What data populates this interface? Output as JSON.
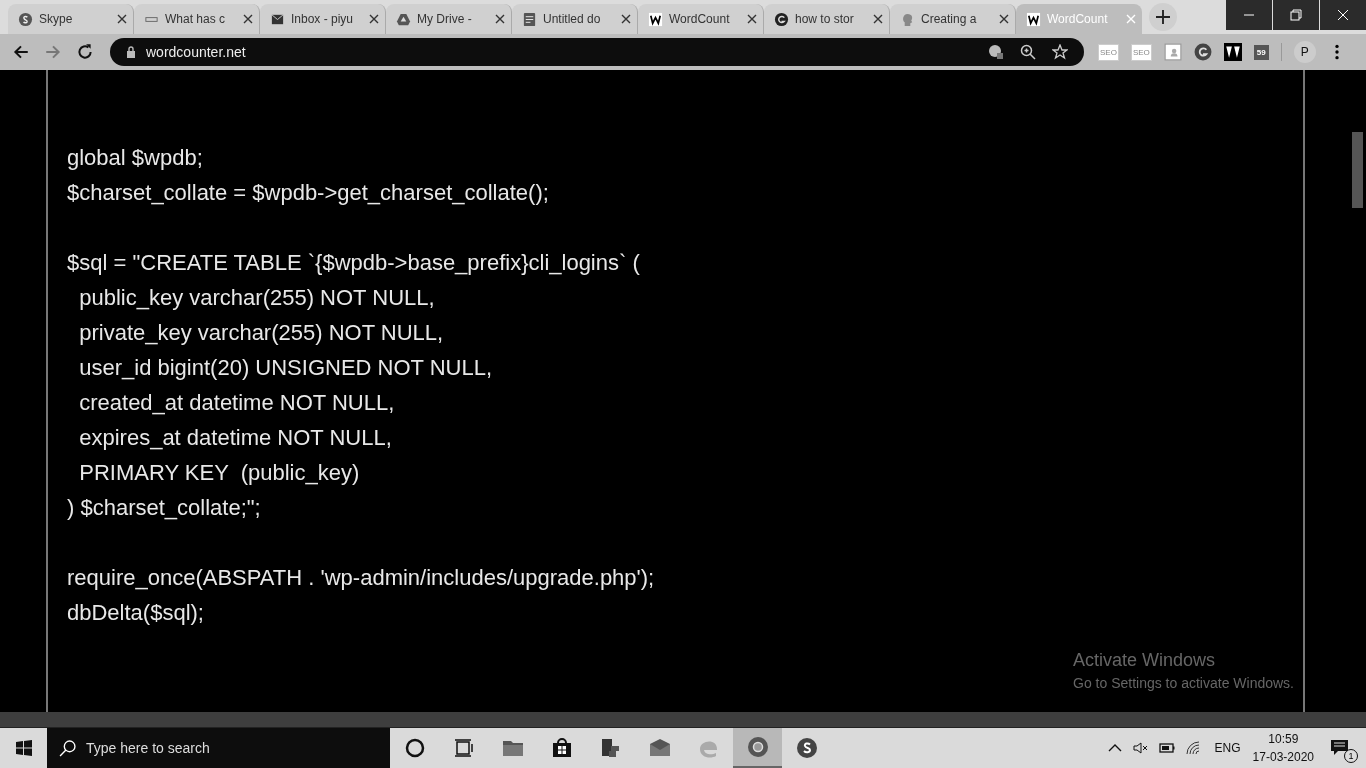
{
  "tabs": [
    {
      "title": "Skype",
      "kind": "skype",
      "selected": false
    },
    {
      "title": "What has c",
      "kind": "dsm",
      "selected": false
    },
    {
      "title": "Inbox - piyu",
      "kind": "mail",
      "selected": false
    },
    {
      "title": "My Drive -",
      "kind": "drive",
      "selected": false
    },
    {
      "title": "Untitled do",
      "kind": "doc",
      "selected": false
    },
    {
      "title": "WordCount",
      "kind": "w",
      "selected": false
    },
    {
      "title": "how to stor",
      "kind": "g",
      "selected": false
    },
    {
      "title": "Creating a",
      "kind": "head",
      "selected": false
    },
    {
      "title": "WordCount",
      "kind": "w",
      "selected": true
    }
  ],
  "address_bar": {
    "url": "wordcounter.net"
  },
  "extensions": [
    {
      "kind": "seo",
      "text": "SEO"
    },
    {
      "kind": "seo",
      "text": "SEO"
    },
    {
      "kind": "contact"
    },
    {
      "kind": "grammarly"
    },
    {
      "kind": "av"
    },
    {
      "kind": "counter",
      "text": "59"
    }
  ],
  "profile": {
    "initial": "P"
  },
  "code_blocks": [
    [
      "global $wpdb;",
      "$charset_collate = $wpdb->get_charset_collate();"
    ],
    [
      "$sql = \"CREATE TABLE `{$wpdb->base_prefix}cli_logins` (",
      "  public_key varchar(255) NOT NULL,",
      "  private_key varchar(255) NOT NULL,",
      "  user_id bigint(20) UNSIGNED NOT NULL,",
      "  created_at datetime NOT NULL,",
      "  expires_at datetime NOT NULL,",
      "  PRIMARY KEY  (public_key)",
      ") $charset_collate;\";"
    ],
    [
      "require_once(ABSPATH . 'wp-admin/includes/upgrade.php');",
      "dbDelta($sql);"
    ]
  ],
  "activation_notice": {
    "title": "Activate Windows",
    "text": "Go to Settings to activate Windows."
  },
  "taskbar": {
    "search_placeholder": "Type here to search",
    "apps": [
      {
        "kind": "cortana",
        "active": false
      },
      {
        "kind": "taskview",
        "active": false
      },
      {
        "kind": "folder",
        "active": false
      },
      {
        "kind": "store",
        "active": false
      },
      {
        "kind": "python",
        "active": false
      },
      {
        "kind": "mail",
        "active": false
      },
      {
        "kind": "edge",
        "active": false
      },
      {
        "kind": "chrome",
        "active": true
      },
      {
        "kind": "skype",
        "active": false
      }
    ],
    "language": "ENG",
    "time": "10:59",
    "date": "17-03-2020",
    "notifications": "1"
  }
}
